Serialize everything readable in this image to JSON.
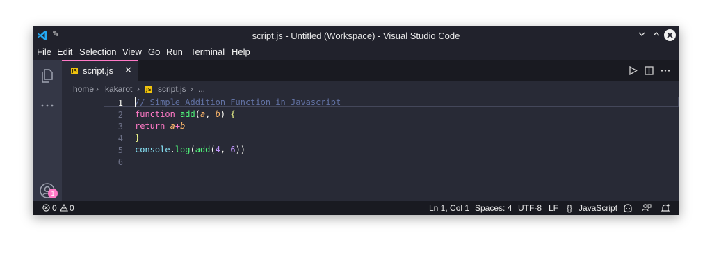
{
  "window": {
    "title": "script.js - Untitled (Workspace) - Visual Studio Code"
  },
  "menu": [
    "File",
    "Edit",
    "Selection",
    "View",
    "Go",
    "Run",
    "Terminal",
    "Help"
  ],
  "activity": {
    "accounts_badge": "1"
  },
  "tab": {
    "filename": "script.js",
    "icon_text": "JS",
    "close": "✕"
  },
  "breadcrumb": {
    "parts": [
      "home",
      "kakarot",
      "script.js",
      "..."
    ],
    "separator": "›"
  },
  "editor": {
    "line_numbers": [
      "1",
      "2",
      "3",
      "4",
      "5",
      "6"
    ],
    "lines": [
      {
        "tokens": [
          {
            "t": "// Simple Addition Function in Javascript",
            "k": "comment"
          }
        ]
      },
      {
        "tokens": [
          {
            "t": "function",
            "k": "keyword"
          },
          {
            "t": " ",
            "k": "plain"
          },
          {
            "t": "add",
            "k": "func"
          },
          {
            "t": "(",
            "k": "plain"
          },
          {
            "t": "a",
            "k": "param"
          },
          {
            "t": ", ",
            "k": "plain"
          },
          {
            "t": "b",
            "k": "param"
          },
          {
            "t": ") ",
            "k": "plain"
          },
          {
            "t": "{",
            "k": "brace"
          }
        ]
      },
      {
        "tokens": [
          {
            "t": "return",
            "k": "keyword"
          },
          {
            "t": " ",
            "k": "plain"
          },
          {
            "t": "a",
            "k": "param"
          },
          {
            "t": "+",
            "k": "keyword"
          },
          {
            "t": "b",
            "k": "param"
          }
        ]
      },
      {
        "tokens": [
          {
            "t": "}",
            "k": "brace"
          }
        ]
      },
      {
        "tokens": [
          {
            "t": "console",
            "k": "ident"
          },
          {
            "t": ".",
            "k": "plain"
          },
          {
            "t": "log",
            "k": "func"
          },
          {
            "t": "(",
            "k": "plain"
          },
          {
            "t": "add",
            "k": "func"
          },
          {
            "t": "(",
            "k": "plain"
          },
          {
            "t": "4",
            "k": "num"
          },
          {
            "t": ", ",
            "k": "plain"
          },
          {
            "t": "6",
            "k": "num"
          },
          {
            "t": "))",
            "k": "plain"
          }
        ]
      },
      {
        "tokens": []
      }
    ]
  },
  "status": {
    "errors": "0",
    "warnings": "0",
    "position": "Ln 1, Col 1",
    "spaces": "Spaces: 4",
    "encoding": "UTF-8",
    "eol": "LF",
    "language": "JavaScript",
    "language_icon": "{}"
  },
  "colors": {
    "accent": "#ff79c6",
    "editor_bg": "#282a36",
    "titlebar_bg": "#21222c",
    "statusbar_bg": "#191a21"
  }
}
